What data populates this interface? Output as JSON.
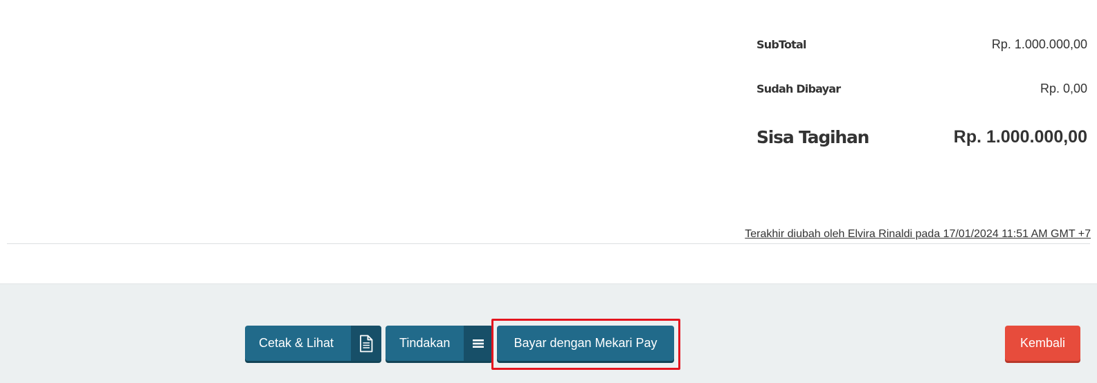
{
  "totals": {
    "subtotal": {
      "label": "SubTotal",
      "value": "Rp. 1.000.000,00"
    },
    "paid": {
      "label": "Sudah Dibayar",
      "value": "Rp. 0,00"
    },
    "remaining": {
      "label": "Sisa Tagihan",
      "value": "Rp. 1.000.000,00"
    }
  },
  "last_modified": "Terakhir diubah oleh Elvira Rinaldi pada 17/01/2024 11:51 AM GMT +7",
  "footer": {
    "print_button": {
      "label": "Cetak & Lihat",
      "icon": "document-icon"
    },
    "actions_button": {
      "label": "Tindakan",
      "icon": "menu-icon"
    },
    "pay_button": {
      "label": "Bayar dengan Mekari Pay"
    },
    "back_button": {
      "label": "Kembali"
    }
  },
  "colors": {
    "primary": "#216a8a",
    "primary_dark": "#174f68",
    "danger": "#e74c3c",
    "highlight": "#e4151f",
    "footer_bg": "#ecf0f1"
  }
}
